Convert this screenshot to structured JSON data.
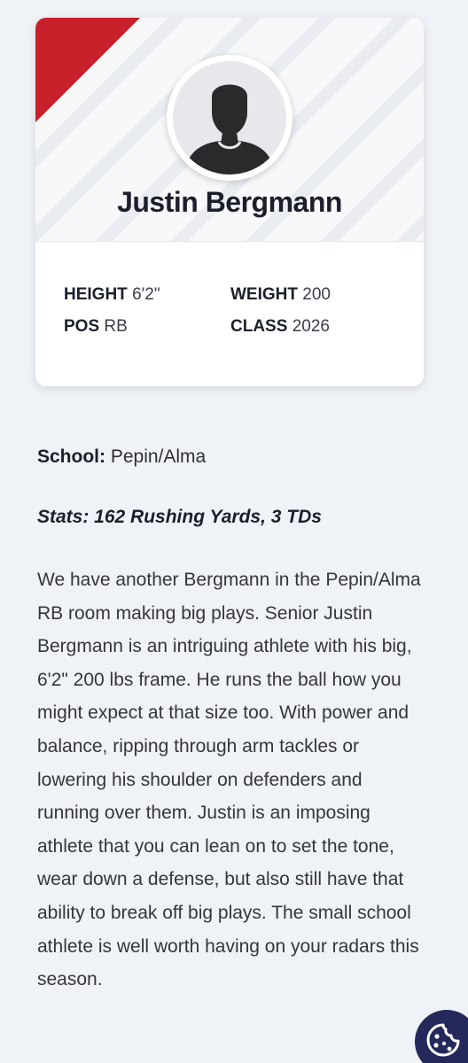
{
  "profile": {
    "name": "Justin Bergmann",
    "height_label": "HEIGHT",
    "height_value": "6'2\"",
    "weight_label": "WEIGHT",
    "weight_value": "200",
    "pos_label": "POS",
    "pos_value": "RB",
    "class_label": "CLASS",
    "class_value": "2026"
  },
  "article": {
    "school_label": "School:",
    "school_value": "Pepin/Alma",
    "stats": "Stats: 162 Rushing Yards, 3 TDs",
    "bio": "We have another Bergmann in the Pepin/Alma RB room making big plays. Senior Justin Bergmann is an intriguing athlete with his big, 6'2\" 200 lbs frame. He runs the ball how you might expect at that size too. With power and balance, ripping through arm tackles or lowering his shoulder on defenders and running over them. Justin is an imposing athlete that you can lean on to set the tone, wear down a defense, but also still have that ability to break off big plays. The small school athlete is well worth having on your radars this season."
  },
  "icons": {
    "avatar": "person-silhouette-icon",
    "cookie": "cookie-icon"
  },
  "colors": {
    "accent": "#c8202b",
    "background": "#eff2f6",
    "cookie_button": "#24285a"
  }
}
